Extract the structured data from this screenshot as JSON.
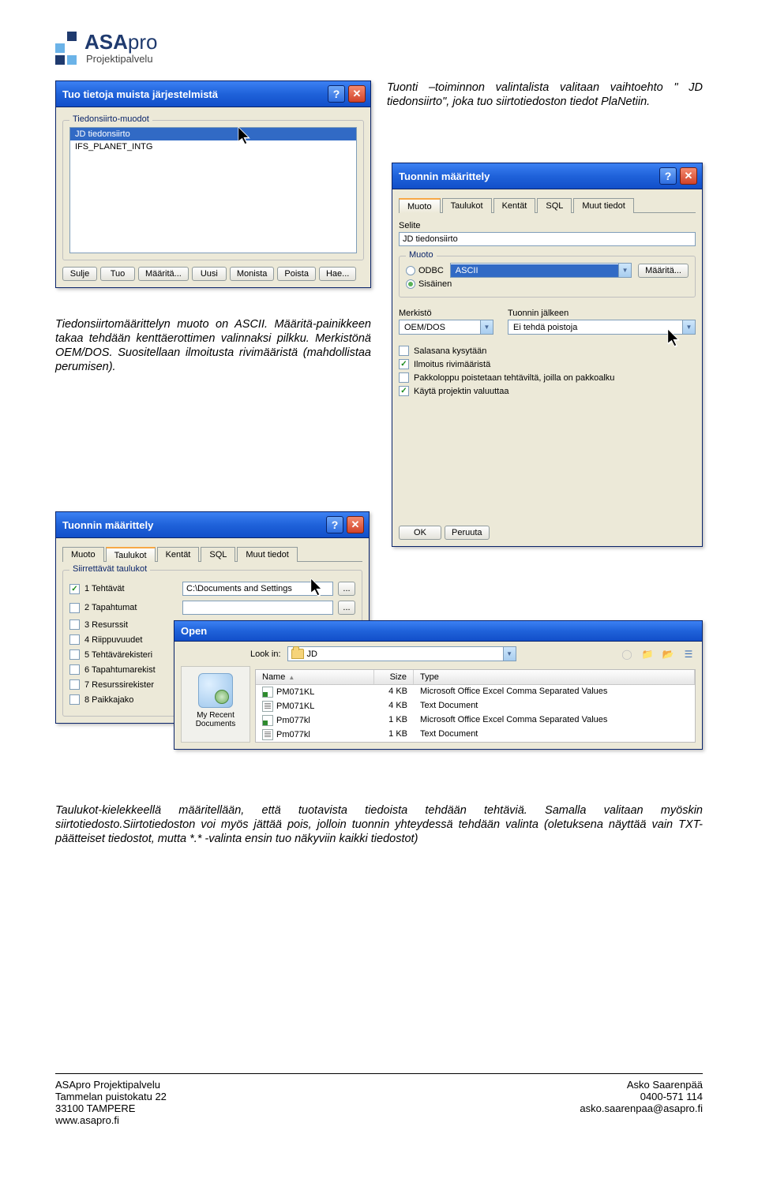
{
  "logo": {
    "word1": "ASA",
    "word2": "pro",
    "sub": "Projektipalvelu"
  },
  "text1": "Tuonti –toiminnon valintalista valitaan vaihtoehto \" JD tiedonsiirto\", joka tuo siirtotiedoston tiedot PlaNetiin.",
  "text2": "Tiedonsiirtomäärittelyn muoto on ASCII. Määritä-painikkeen takaa tehdään kenttäerottimen valinnaksi pilkku. Merkistönä OEM/DOS. Suositellaan ilmoitusta rivimääristä (mahdollistaa perumisen).",
  "text3": "Taulukot-kielekkeellä määritellään, että tuotavista tiedoista tehdään tehtäviä. Samalla valitaan myöskin siirtotiedosto.Siirtotiedoston voi myös jättää pois, jolloin tuonnin yhteydessä tehdään valinta (oletuksena näyttää vain TXT-päätteiset tiedostot, mutta *.* -valinta ensin tuo näkyviin kaikki tiedostot)",
  "win1": {
    "title": "Tuo tietoja muista järjestelmistä",
    "group": "Tiedonsiirto-muodot",
    "items": [
      "JD tiedonsiirto",
      "IFS_PLANET_INTG"
    ],
    "buttons": [
      "Sulje",
      "Tuo",
      "Määritä...",
      "Uusi",
      "Monista",
      "Poista",
      "Hae..."
    ]
  },
  "win2": {
    "title": "Tuonnin määrittely",
    "tabs": [
      "Muoto",
      "Taulukot",
      "Kentät",
      "SQL",
      "Muut tiedot"
    ],
    "selite_label": "Selite",
    "selite_value": "JD tiedonsiirto",
    "muoto_legend": "Muoto",
    "radio_odbc": "ODBC",
    "radio_sis": "Sisäinen",
    "ascii_sel": "ASCII",
    "maarita_btn": "Määritä...",
    "merkisto_label": "Merkistö",
    "merkisto_value": "OEM/DOS",
    "jalkeen_label": "Tuonnin jälkeen",
    "jalkeen_value": "Ei tehdä poistoja",
    "checks": [
      {
        "label": "Salasana kysytään",
        "checked": false
      },
      {
        "label": "Ilmoitus rivimääristä",
        "checked": true
      },
      {
        "label": "Pakkoloppu poistetaan tehtäviltä, joilla on pakkoalku",
        "checked": false
      },
      {
        "label": "Käytä projektin valuuttaa",
        "checked": true
      }
    ],
    "ok": "OK",
    "cancel": "Peruuta"
  },
  "win3": {
    "title": "Tuonnin määrittely",
    "tabs": [
      "Muoto",
      "Taulukot",
      "Kentät",
      "SQL",
      "Muut tiedot"
    ],
    "group": "Siirrettävät taulukot",
    "rows": [
      {
        "label": "1 Tehtävät",
        "checked": true,
        "path": "C:\\Documents and Settings"
      },
      {
        "label": "2 Tapahtumat",
        "checked": false,
        "path": ""
      },
      {
        "label": "3 Resurssit",
        "checked": false,
        "path": ""
      },
      {
        "label": "4 Riippuvuudet",
        "checked": false,
        "path": ""
      },
      {
        "label": "5 Tehtävärekisteri",
        "checked": false,
        "path": ""
      },
      {
        "label": "6 Tapahtumarekist",
        "checked": false,
        "path": ""
      },
      {
        "label": "7 Resurssirekister",
        "checked": false,
        "path": ""
      },
      {
        "label": "8 Paikkajako",
        "checked": false,
        "path": ""
      }
    ]
  },
  "win4": {
    "title": "Open",
    "lookin_label": "Look in:",
    "lookin_value": "JD",
    "place_label": "My Recent Documents",
    "cols": {
      "name": "Name",
      "size": "Size",
      "type": "Type"
    },
    "files": [
      {
        "name": "PM071KL",
        "size": "4 KB",
        "type": "Microsoft Office Excel Comma Separated Values",
        "kind": "xls"
      },
      {
        "name": "PM071KL",
        "size": "4 KB",
        "type": "Text Document",
        "kind": "txt"
      },
      {
        "name": "Pm077kl",
        "size": "1 KB",
        "type": "Microsoft Office Excel Comma Separated Values",
        "kind": "xls"
      },
      {
        "name": "Pm077kl",
        "size": "1 KB",
        "type": "Text Document",
        "kind": "txt"
      }
    ]
  },
  "footer": {
    "l1": "ASApro Projektipalvelu",
    "l2": "Tammelan puistokatu 22",
    "l3": "33100 TAMPERE",
    "l4": "www.asapro.fi",
    "r1": "Asko Saarenpää",
    "r2": "0400-571 114",
    "r3": "asko.saarenpaa@asapro.fi"
  }
}
